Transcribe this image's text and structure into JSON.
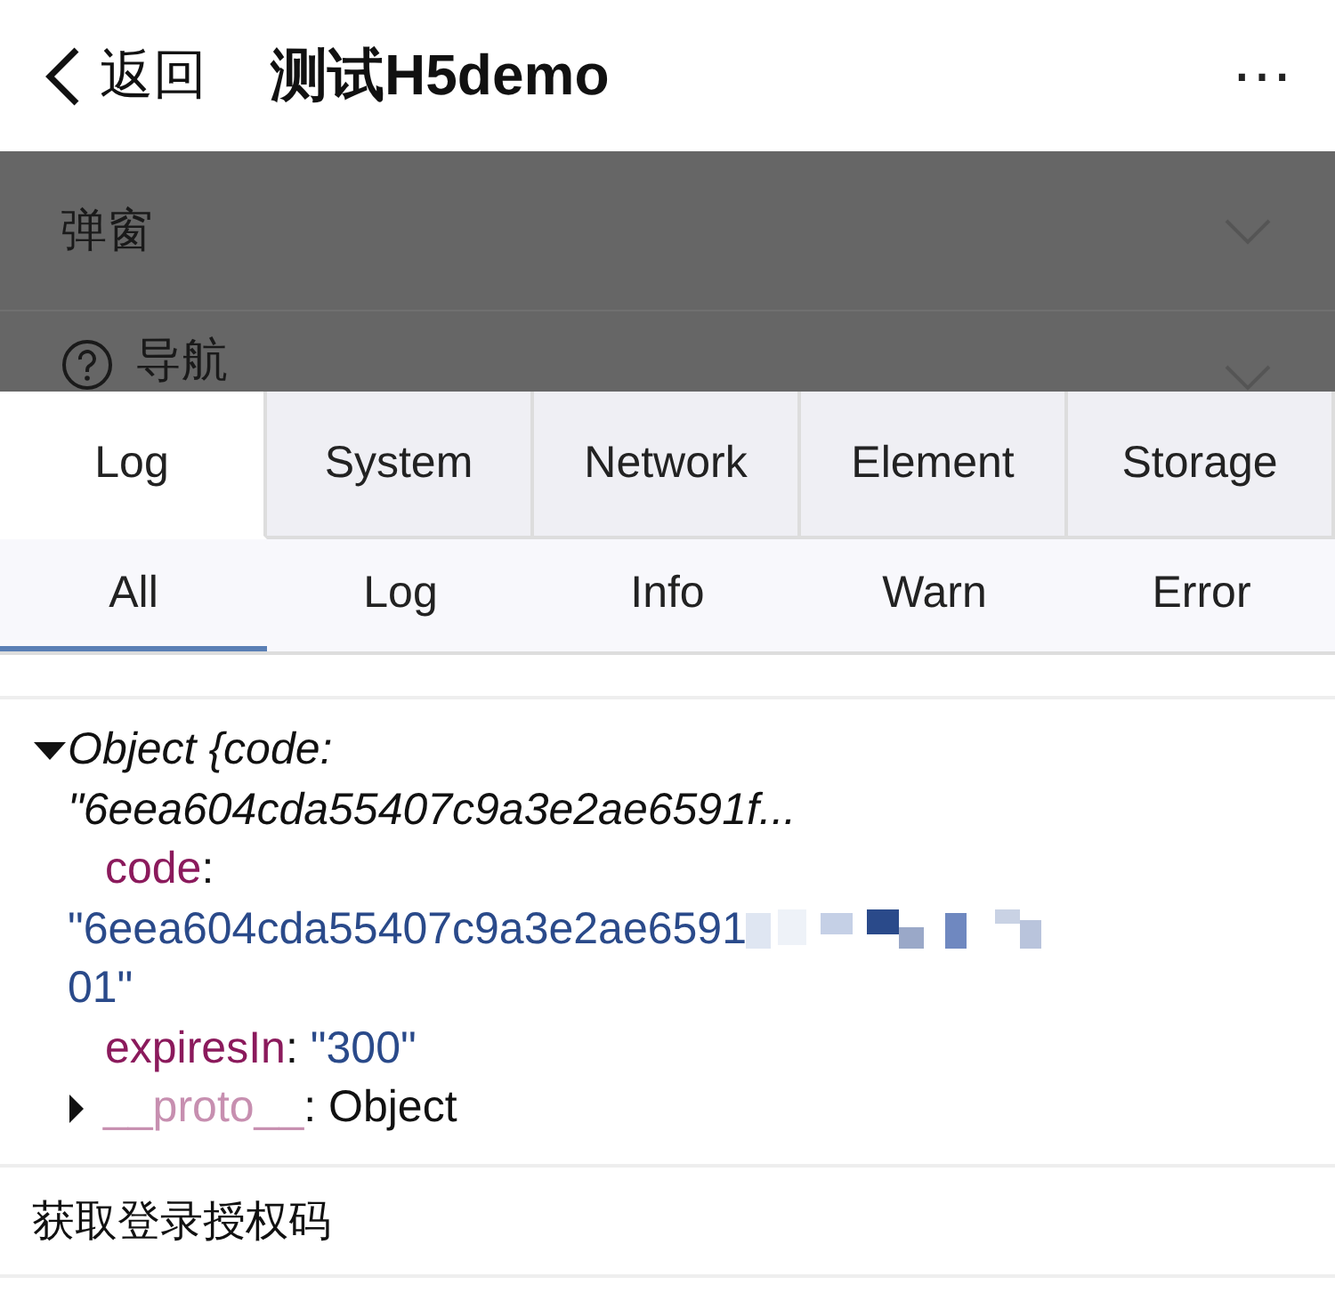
{
  "header": {
    "back": "返回",
    "title": "测试H5demo",
    "more": "⋯"
  },
  "menu": [
    {
      "label": "弹窗",
      "help": false
    },
    {
      "label": "导航",
      "help": true
    }
  ],
  "tabs": [
    {
      "label": "Log",
      "selected": true
    },
    {
      "label": "System",
      "selected": false
    },
    {
      "label": "Network",
      "selected": false
    },
    {
      "label": "Element",
      "selected": false
    },
    {
      "label": "Storage",
      "selected": false
    }
  ],
  "filters": [
    {
      "label": "All",
      "selected": true
    },
    {
      "label": "Log",
      "selected": false
    },
    {
      "label": "Info",
      "selected": false
    },
    {
      "label": "Warn",
      "selected": false
    },
    {
      "label": "Error",
      "selected": false
    }
  ],
  "log": {
    "summary_1": "Object {code:",
    "summary_2": "\"6eea604cda55407c9a3e2ae6591f...",
    "props": [
      {
        "key": "code",
        "sep": ":",
        "value_start": "\"6eea604cda55407c9a3e2ae6591",
        "value_end": "01\""
      },
      {
        "key": "expiresIn",
        "sep": ":",
        "value_start": "\"300\""
      }
    ],
    "proto_key": "__proto__",
    "proto_sep": ":",
    "proto_value": "Object"
  },
  "entries": [
    "获取登录授权码"
  ]
}
